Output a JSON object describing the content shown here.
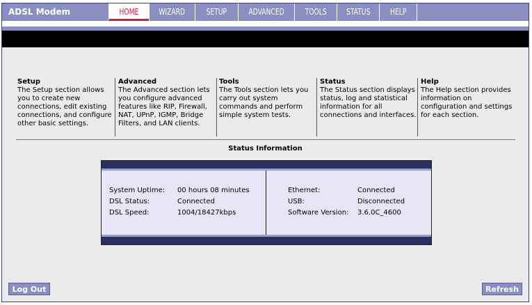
{
  "header": {
    "brand": "ADSL Modem",
    "tabs": [
      {
        "label": "HOME"
      },
      {
        "label": "WIZARD"
      },
      {
        "label": "SETUP"
      },
      {
        "label": "ADVANCED"
      },
      {
        "label": "TOOLS"
      },
      {
        "label": "STATUS"
      },
      {
        "label": "HELP"
      }
    ]
  },
  "sections": [
    {
      "title": "Setup",
      "desc": "The Setup section allows you to create new connections, edit existing connections, and configure other basic settings."
    },
    {
      "title": "Advanced",
      "desc": "The Advanced section lets you configure advanced features like RIP, Firewall, NAT, UPnP, IGMP, Bridge Filters, and LAN clients."
    },
    {
      "title": "Tools",
      "desc": "The Tools section lets you carry out system commands and perform simple system tests."
    },
    {
      "title": "Status",
      "desc": "The Status section displays status, log and statistical information for all connections and interfaces."
    },
    {
      "title": "Help",
      "desc": "The Help section provides information on configuration and settings for each section."
    }
  ],
  "status": {
    "title": "Status Information",
    "left": [
      {
        "label": "System Uptime:",
        "value": "00 hours 08 minutes"
      },
      {
        "label": "DSL Status:",
        "value": "Connected"
      },
      {
        "label": "DSL Speed:",
        "value": "1004/18427kbps"
      }
    ],
    "right": [
      {
        "label": "Ethernet:",
        "value": "Connected"
      },
      {
        "label": "USB:",
        "value": "Disconnected"
      },
      {
        "label": "Software Version:",
        "value": "3.6.0C_4600"
      }
    ]
  },
  "footer": {
    "logout": "Log Out",
    "refresh": "Refresh"
  }
}
